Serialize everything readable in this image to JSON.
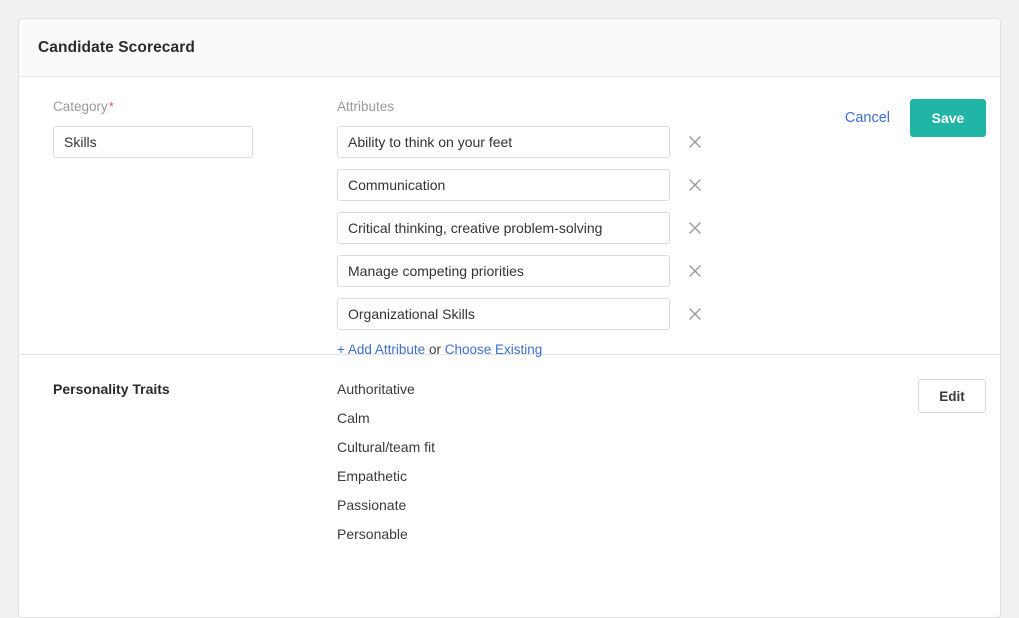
{
  "card": {
    "title": "Candidate Scorecard"
  },
  "edit_section": {
    "category": {
      "label": "Category",
      "required_marker": "*",
      "value": "Skills",
      "placeholder": "Category"
    },
    "attributes": {
      "label": "Attributes",
      "placeholder": "Attribute",
      "items": [
        {
          "value": "Ability to think on your feet",
          "remove_icon": "close-icon"
        },
        {
          "value": "Communication",
          "remove_icon": "close-icon"
        },
        {
          "value": "Critical thinking, creative problem-solving",
          "remove_icon": "close-icon"
        },
        {
          "value": "Manage competing priorities",
          "remove_icon": "close-icon"
        },
        {
          "value": "Organizational Skills",
          "remove_icon": "close-icon"
        }
      ],
      "add_link": "+ Add Attribute",
      "separator": " or ",
      "choose_existing_link": "Choose Existing"
    },
    "actions": {
      "cancel_label": "Cancel",
      "save_label": "Save"
    }
  },
  "view_section": {
    "name": "Personality Traits",
    "values": [
      "Authoritative",
      "Calm",
      "Cultural/team fit",
      "Empathetic",
      "Passionate",
      "Personable"
    ],
    "edit_label": "Edit"
  },
  "colors": {
    "save_button": "#21b5a5",
    "link": "#3f6fce",
    "required_star": "#e0536f",
    "header_background": "#fafafa",
    "page_background": "#f1f1f1"
  }
}
